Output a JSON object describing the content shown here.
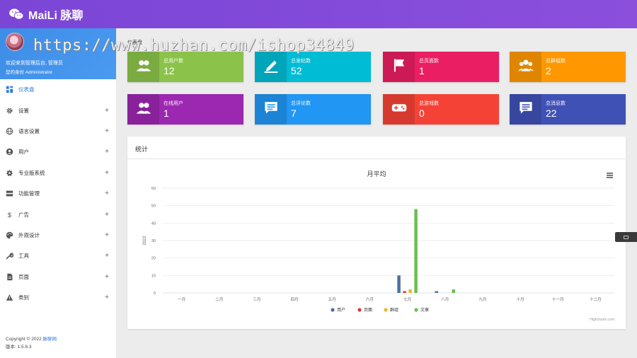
{
  "app": {
    "title": "MaiLi 脉聊"
  },
  "user": {
    "welcome": "欢迎来到管理后台, 管理员",
    "role": "您的身份 Administrator"
  },
  "menu": [
    {
      "label": "仪表盘",
      "icon": "dashboard-icon",
      "active": true,
      "expandable": false
    },
    {
      "label": "设置",
      "icon": "gear-icon",
      "expandable": true
    },
    {
      "label": "语言设置",
      "icon": "globe-icon",
      "expandable": true
    },
    {
      "label": "用户",
      "icon": "user-icon",
      "expandable": true
    },
    {
      "label": "专业版系统",
      "icon": "star-badge-icon",
      "expandable": true
    },
    {
      "label": "功能管理",
      "icon": "server-icon",
      "expandable": true
    },
    {
      "label": "广告",
      "icon": "dollar-icon",
      "expandable": true
    },
    {
      "label": "外观设计",
      "icon": "palette-icon",
      "expandable": true
    },
    {
      "label": "工具",
      "icon": "wrench-icon",
      "expandable": true
    },
    {
      "label": "页面",
      "icon": "page-icon",
      "expandable": true
    },
    {
      "label": "类别",
      "icon": "warning-icon",
      "expandable": true
    }
  ],
  "footer": {
    "copyright": "Copyright © 2022 ",
    "copyright_link": "脉聊网",
    "version": "版本: 1.5.6.3"
  },
  "breadcrumb": "仪表盘",
  "stats": [
    {
      "label": "总用户数",
      "value": "12",
      "color": "#8bc34a",
      "icon": "users-icon"
    },
    {
      "label": "总发帖数",
      "value": "52",
      "color": "#00bcd4",
      "icon": "edit-icon"
    },
    {
      "label": "总页面数",
      "value": "1",
      "color": "#e91e63",
      "icon": "flag-icon"
    },
    {
      "label": "总群组数",
      "value": "2",
      "color": "#ff9800",
      "icon": "group-icon"
    },
    {
      "label": "在线用户",
      "value": "1",
      "color": "#9c27b0",
      "icon": "users-icon"
    },
    {
      "label": "总评论数",
      "value": "7",
      "color": "#2196f3",
      "icon": "comment-icon"
    },
    {
      "label": "总游戏数",
      "value": "0",
      "color": "#f44336",
      "icon": "gamepad-icon"
    },
    {
      "label": "总消息数",
      "value": "22",
      "color": "#3f51b5",
      "icon": "message-icon"
    }
  ],
  "panel": {
    "title": "统计"
  },
  "watermark": "https://www.huzhan.com/ishop34849",
  "chart_data": {
    "type": "bar",
    "title": "月平均",
    "ylabel": "2022",
    "ylim": [
      0,
      60
    ],
    "yticks": [
      0,
      10,
      20,
      30,
      40,
      50,
      60
    ],
    "categories": [
      "一月",
      "二月",
      "三月",
      "四月",
      "五月",
      "六月",
      "七月",
      "八月",
      "九月",
      "十月",
      "十一月",
      "十二月"
    ],
    "series": [
      {
        "name": "用户",
        "color": "#4a6fa5",
        "values": [
          0,
          0,
          0,
          0,
          0,
          0,
          10,
          1,
          0,
          0,
          0,
          0
        ]
      },
      {
        "name": "页面",
        "color": "#d9383a",
        "values": [
          0,
          0,
          0,
          0,
          0,
          0,
          1,
          0,
          0,
          0,
          0,
          0
        ]
      },
      {
        "name": "群组",
        "color": "#e8b731",
        "values": [
          0,
          0,
          0,
          0,
          0,
          0,
          2,
          0,
          0,
          0,
          0,
          0
        ]
      },
      {
        "name": "文章",
        "color": "#6bbf4e",
        "values": [
          0,
          0,
          0,
          0,
          0,
          0,
          48,
          2,
          0,
          0,
          0,
          0
        ]
      }
    ],
    "grid": true,
    "legend": "bottom",
    "credit": "Highcharts.com"
  }
}
